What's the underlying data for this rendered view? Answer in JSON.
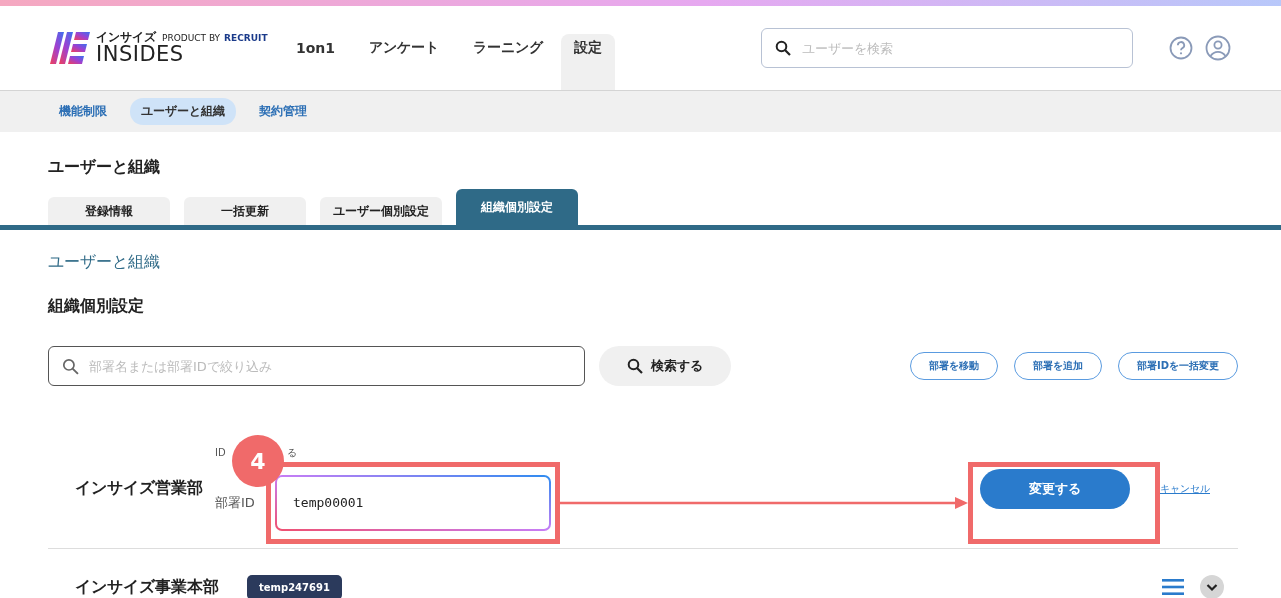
{
  "header": {
    "logo": {
      "kana": "インサイズ",
      "product_by": "PRODUCT BY",
      "brand": "RECRUIT",
      "name": "INSIDES"
    },
    "nav": [
      {
        "label": "1on1",
        "selected": false
      },
      {
        "label": "アンケート",
        "selected": false
      },
      {
        "label": "ラーニング",
        "selected": false
      },
      {
        "label": "設定",
        "selected": true
      }
    ],
    "search": {
      "placeholder": "ユーザーを検索"
    }
  },
  "subnav": [
    {
      "label": "機能制限",
      "selected": false
    },
    {
      "label": "ユーザーと組織",
      "selected": true
    },
    {
      "label": "契約管理",
      "selected": false
    }
  ],
  "page_title": "ユーザーと組織",
  "tabs": [
    {
      "label": "登録情報",
      "selected": false
    },
    {
      "label": "一括更新",
      "selected": false
    },
    {
      "label": "ユーザー個別設定",
      "selected": false
    },
    {
      "label": "組織個別設定",
      "selected": true
    }
  ],
  "breadcrumb": "ユーザーと組織",
  "heading": "組織個別設定",
  "filter": {
    "placeholder": "部署名または部署IDで絞り込み",
    "search_button": "検索する"
  },
  "actions": [
    "部署を移動",
    "部署を追加",
    "部署IDを一括変更"
  ],
  "departments": [
    {
      "kind": "editing",
      "name": "インサイズ営業部",
      "hint_start": "ID",
      "hint_end": "る",
      "field_label": "部署ID",
      "value": "temp00001",
      "save": "変更する",
      "cancel": "キャンセル"
    },
    {
      "kind": "view",
      "name": "インサイズ事業本部",
      "id": "temp247691"
    }
  ],
  "annotation": {
    "step": "4"
  }
}
